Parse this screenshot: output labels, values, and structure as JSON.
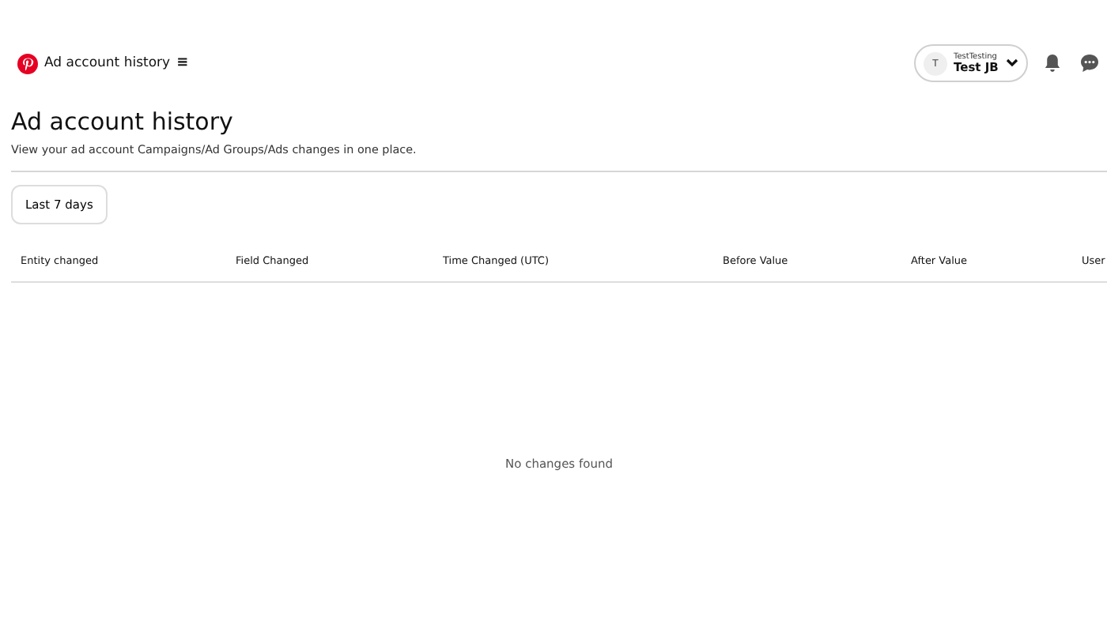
{
  "header": {
    "title": "Ad account history",
    "menu_glyph": "≡",
    "account": {
      "avatar": "T",
      "business": "TestTesting",
      "name": "Test JB"
    }
  },
  "page": {
    "title": "Ad account history",
    "subtitle": "View your ad account Campaigns/Ad Groups/Ads changes in one place."
  },
  "filter": {
    "label": "Last 7 days"
  },
  "table": {
    "columns": [
      "Entity changed",
      "Field Changed",
      "Time Changed (UTC)",
      "Before Value",
      "After Value",
      "User"
    ],
    "empty_message": "No changes found"
  }
}
